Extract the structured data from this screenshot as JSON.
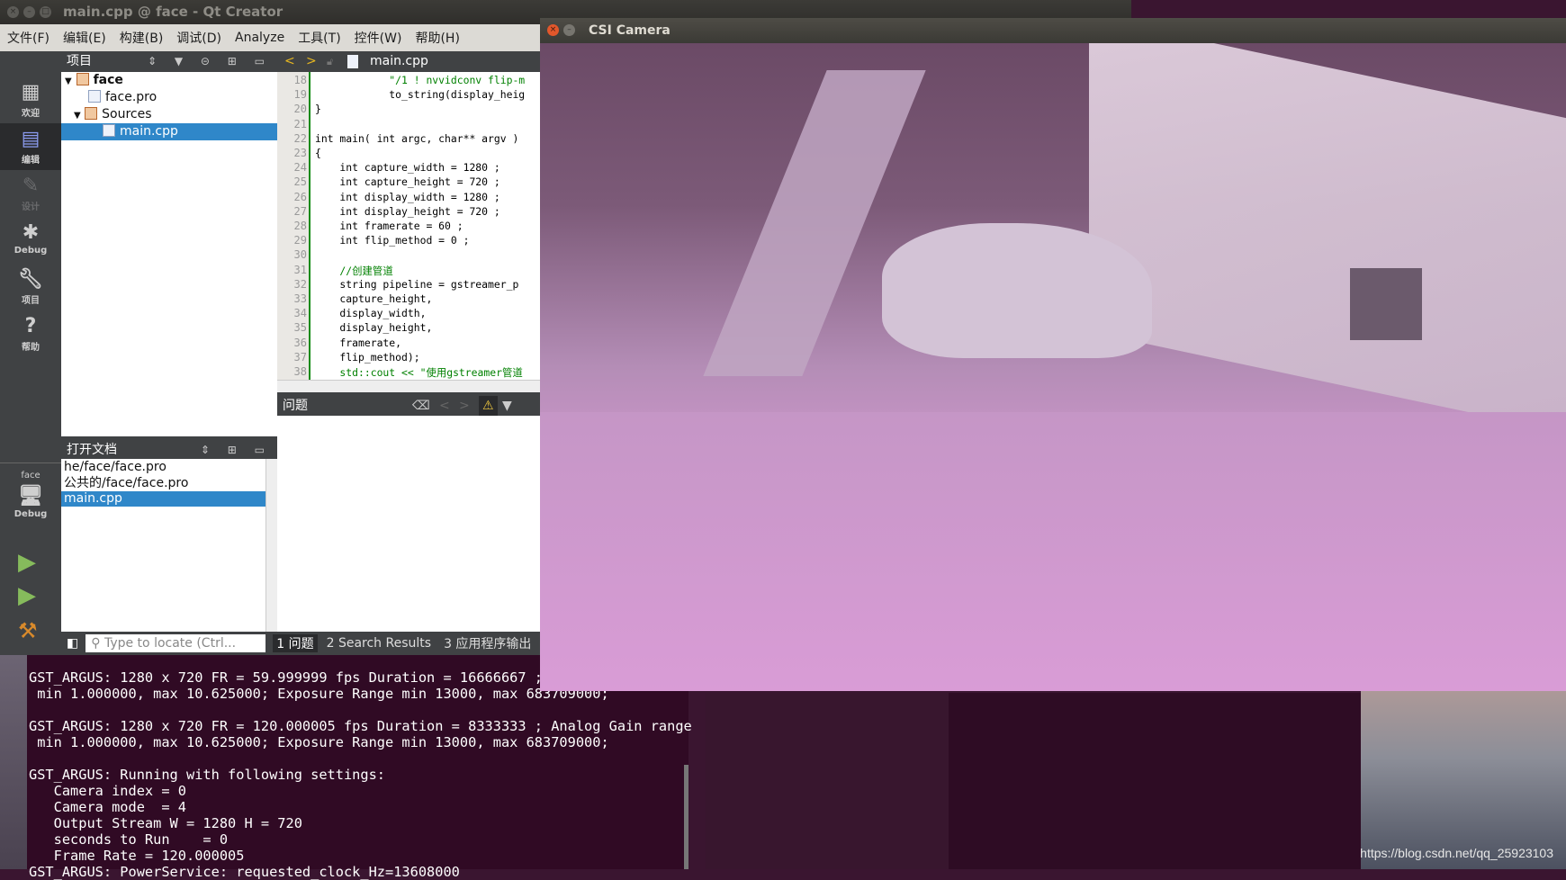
{
  "qt_window": {
    "title": "main.cpp @ face - Qt Creator"
  },
  "menu": [
    "文件(F)",
    "编辑(E)",
    "构建(B)",
    "调试(D)",
    "Analyze",
    "工具(T)",
    "控件(W)",
    "帮助(H)"
  ],
  "modes": [
    {
      "label": "欢迎",
      "icon": "grid-icon"
    },
    {
      "label": "编辑",
      "icon": "edit-doc-icon",
      "active": true
    },
    {
      "label": "设计",
      "icon": "pencil-icon",
      "disabled": true
    },
    {
      "label": "Debug",
      "icon": "bug-icon"
    },
    {
      "label": "项目",
      "icon": "wrench-icon"
    },
    {
      "label": "帮助",
      "icon": "help-icon"
    }
  ],
  "kit": {
    "project": "face",
    "build": "Debug"
  },
  "project_pane": {
    "title": "项目",
    "tree": [
      {
        "label": "face",
        "level": 0
      },
      {
        "label": "face.pro",
        "level": 1
      },
      {
        "label": "Sources",
        "level": 1
      },
      {
        "label": "main.cpp",
        "level": 2,
        "selected": true
      }
    ]
  },
  "open_docs": {
    "title": "打开文档",
    "items": [
      {
        "label": "he/face/face.pro"
      },
      {
        "label": "公共的/face/face.pro"
      },
      {
        "label": "main.cpp",
        "selected": true
      }
    ]
  },
  "editor": {
    "file": "main.cpp",
    "lines": [
      {
        "n": "18",
        "t": "            \"/1 ! nvvidconv flip-m"
      },
      {
        "n": "19",
        "t": "            to_string(display_heig"
      },
      {
        "n": "20",
        "t": "}"
      },
      {
        "n": "21",
        "t": ""
      },
      {
        "n": "22",
        "t": "int main( int argc, char** argv )"
      },
      {
        "n": "23",
        "t": "{"
      },
      {
        "n": "24",
        "t": "    int capture_width = 1280 ;"
      },
      {
        "n": "25",
        "t": "    int capture_height = 720 ;"
      },
      {
        "n": "26",
        "t": "    int display_width = 1280 ;"
      },
      {
        "n": "27",
        "t": "    int display_height = 720 ;"
      },
      {
        "n": "28",
        "t": "    int framerate = 60 ;"
      },
      {
        "n": "29",
        "t": "    int flip_method = 0 ;"
      },
      {
        "n": "30",
        "t": ""
      },
      {
        "n": "31",
        "t": "    //创建管道"
      },
      {
        "n": "32",
        "t": "    string pipeline = gstreamer_p"
      },
      {
        "n": "33",
        "t": "    capture_height,"
      },
      {
        "n": "34",
        "t": "    display_width,"
      },
      {
        "n": "35",
        "t": "    display_height,"
      },
      {
        "n": "36",
        "t": "    framerate,"
      },
      {
        "n": "37",
        "t": "    flip_method);"
      },
      {
        "n": "38",
        "t": "    std::cout << \"使用gstreamer管道"
      }
    ]
  },
  "issues": {
    "title": "问题"
  },
  "statusbar": {
    "locate_placeholder": "Type to locate (Ctrl...",
    "tabs": [
      "1 问题",
      "2 Search Results",
      "3 应用程序输出"
    ]
  },
  "terminal": {
    "text": "GST_ARGUS: 1280 x 720 FR = 59.999999 fps Duration = 16666667 ; Analog Gain range\n min 1.000000, max 10.625000; Exposure Range min 13000, max 683709000;\n\nGST_ARGUS: 1280 x 720 FR = 120.000005 fps Duration = 8333333 ; Analog Gain range\n min 1.000000, max 10.625000; Exposure Range min 13000, max 683709000;\n\nGST_ARGUS: Running with following settings:\n   Camera index = 0\n   Camera mode  = 4\n   Output Stream W = 1280 H = 720\n   seconds to Run    = 0\n   Frame Rate = 120.000005\nGST_ARGUS: PowerService: requested_clock_Hz=13608000"
  },
  "camera_window": {
    "title": "CSI Camera"
  },
  "watermark": "https://blog.csdn.net/qq_25923103",
  "colors": {
    "selection": "#2f87c9",
    "terminal_bg": "#300a24",
    "close_button": "#e2572b"
  }
}
